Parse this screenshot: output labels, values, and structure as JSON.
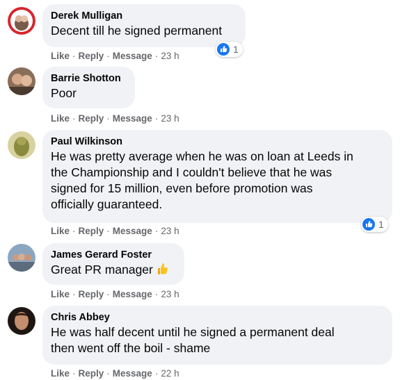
{
  "actions": {
    "like": "Like",
    "reply": "Reply",
    "message": "Message",
    "separator": "·"
  },
  "comments": [
    {
      "author": "Derek Mulligan",
      "text": "Decent till he signed permanent",
      "time": "23 h",
      "reactions": "1"
    },
    {
      "author": "Barrie Shotton",
      "text": "Poor",
      "time": "23 h"
    },
    {
      "author": "Paul Wilkinson",
      "text_lines": [
        "He was pretty average when he was on loan at Leeds in",
        "the Championship and I couldn't believe that he was",
        "signed for 15 million, even before promotion was",
        "officially guaranteed."
      ],
      "time": "23 h",
      "reactions": "1"
    },
    {
      "author": "James Gerard Foster",
      "text": "Great PR manager",
      "emoji": "thumbs-up-emoji",
      "time": "23 h"
    },
    {
      "author": "Chris Abbey",
      "text_lines": [
        "He was half decent until he signed a permanent deal",
        "then went off the boil - shame"
      ],
      "time": "22 h"
    }
  ],
  "colors": {
    "bubble": "#f0f2f5",
    "like_blue": "#1877f2",
    "meta": "#65676b"
  }
}
